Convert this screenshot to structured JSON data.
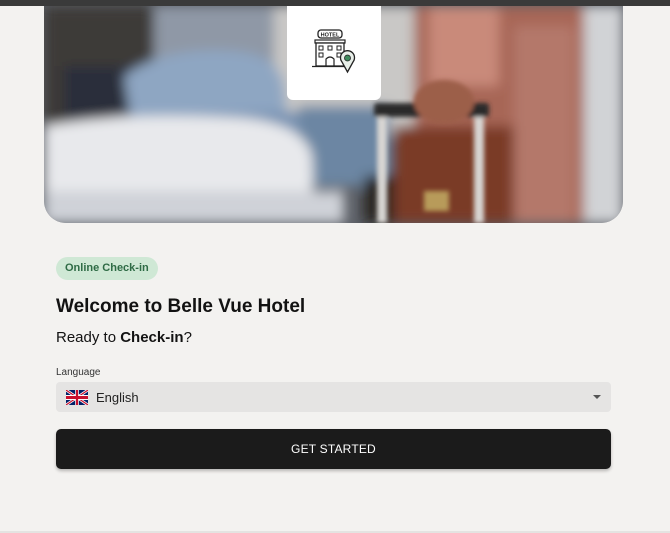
{
  "hero": {
    "image": "hotel-room-traveler-with-suitcase",
    "logo_icon": "hotel-building-icon",
    "logo_text": "HOTEL"
  },
  "checkin": {
    "badge": "Online Check-in",
    "title": "Welcome to Belle Vue Hotel",
    "subtitle_prefix": "Ready to ",
    "subtitle_bold": "Check-in",
    "subtitle_suffix": "?",
    "language_label": "Language",
    "language_value": "English",
    "language_flag": "uk-flag-icon",
    "cta_label": "GET STARTED"
  },
  "colors": {
    "background": "#f3f2f0",
    "badge_bg": "#cfe8d5",
    "badge_text": "#2e6b45",
    "button_bg": "#1b1b1b"
  }
}
